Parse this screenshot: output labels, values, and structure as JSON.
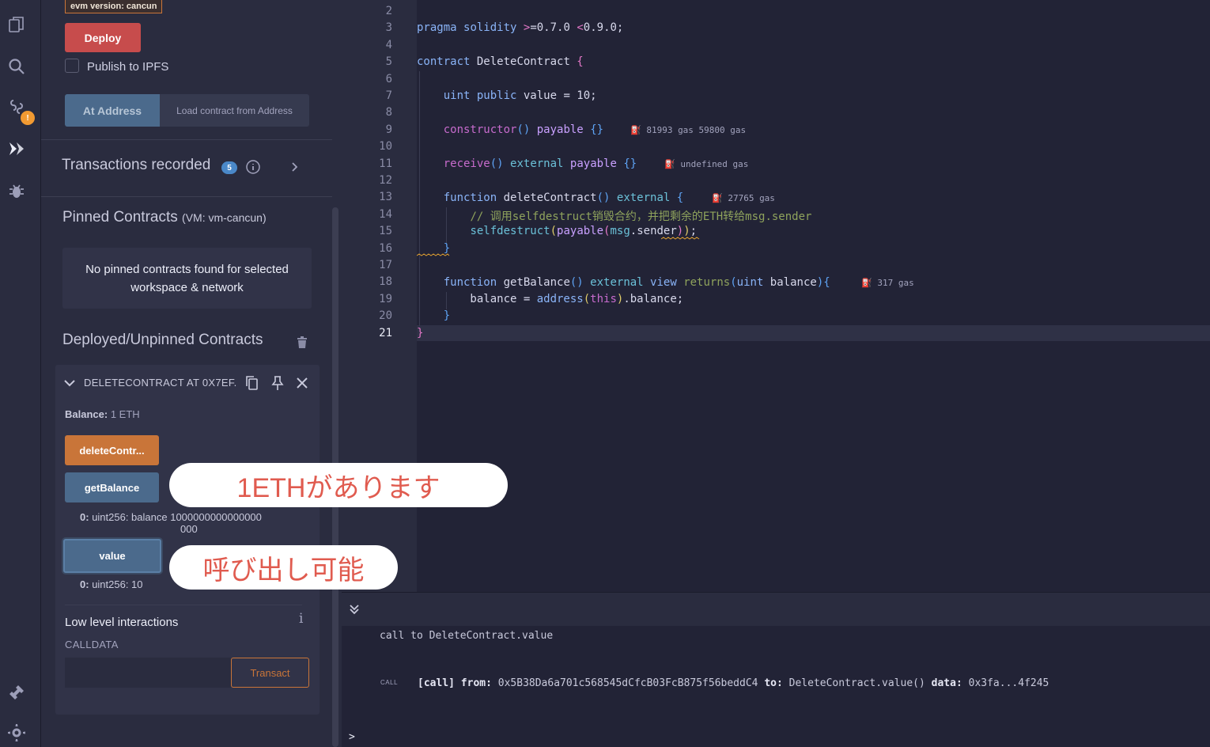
{
  "side_panel": {
    "evm_version": "evm version: cancun",
    "deploy_label": "Deploy",
    "publish_ipfs_label": "Publish to IPFS",
    "at_address_label": "At Address",
    "load_address_placeholder": "Load contract from Address",
    "transactions_recorded": "Transactions recorded",
    "transactions_count": "5",
    "pinned_title": "Pinned Contracts",
    "pinned_vm": "(VM: vm-cancun)",
    "pinned_empty": "No pinned contracts found for selected workspace & network",
    "deployed_title": "Deployed/Unpinned Contracts"
  },
  "instance": {
    "name": "DELETECONTRACT AT 0X7EF.",
    "balance_label": "Balance:",
    "balance_value": "1 ETH",
    "functions": [
      {
        "label": "deleteContr...",
        "color": "orange"
      },
      {
        "label": "getBalance",
        "color": "blue"
      },
      {
        "label": "value",
        "color": "blue"
      }
    ],
    "getbalance_result_index": "0:",
    "getbalance_result_line1": "uint256: balance 1000000000000000",
    "getbalance_result_line2": "000",
    "value_result_index": "0:",
    "value_result": "uint256: 10",
    "low_level_title": "Low level interactions",
    "calldata_label": "CALLDATA",
    "transact_label": "Transact"
  },
  "callouts": {
    "one": "1ETHがあります",
    "two": "呼び出し可能"
  },
  "editor": {
    "line_numbers": [
      "2",
      "3",
      "4",
      "5",
      "6",
      "7",
      "8",
      "9",
      "10",
      "11",
      "12",
      "13",
      "14",
      "15",
      "16",
      "17",
      "18",
      "19",
      "20",
      "21"
    ],
    "active_line": "21",
    "gas": {
      "constructor": "81993 gas 59800 gas",
      "receive": "undefined gas",
      "deleteContract": "27765 gas",
      "getBalance": "317 gas"
    }
  },
  "terminal": {
    "line1": "call to DeleteContract.value",
    "call_tag": "CALL",
    "call_prefix": "[call]",
    "from_label": "from:",
    "from_value": "0x5B38Da6a701c568545dCfcB03FcB875f56beddC4",
    "to_label": "to:",
    "to_value": "DeleteContract.value()",
    "data_label": "data:",
    "data_value": "0x3fa...4f245",
    "prompt": ">"
  }
}
